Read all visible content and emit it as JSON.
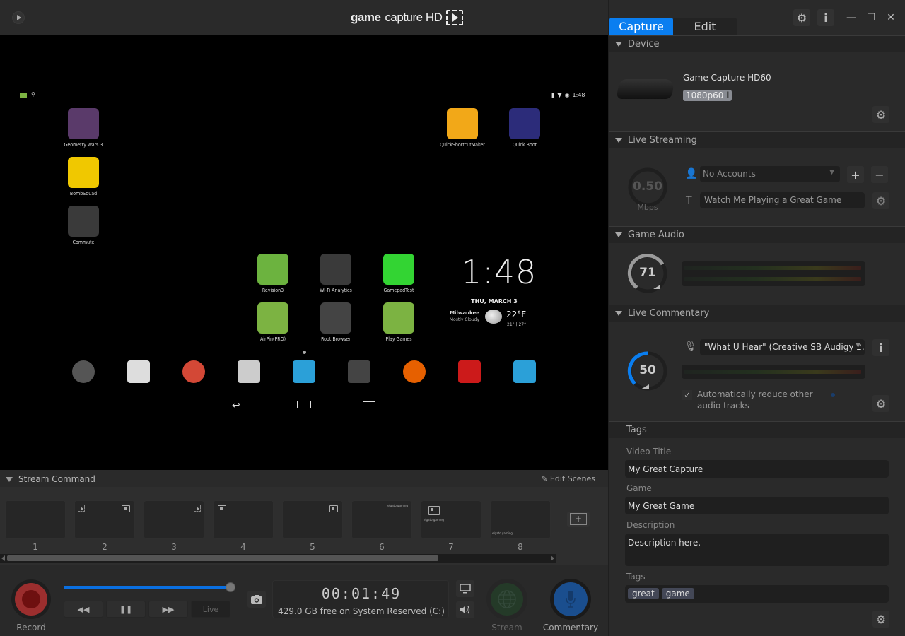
{
  "app": {
    "brand_bold": "game",
    "brand_thin": "capture HD"
  },
  "preview": {
    "status_time": "1:48",
    "apps_left": [
      {
        "label": "Geometry Wars 3",
        "color": "#5a3a6a"
      },
      {
        "label": "BombSquad",
        "color": "#f0c800"
      },
      {
        "label": "Commute",
        "color": "#3a3a3a"
      }
    ],
    "apps_top_right": [
      {
        "label": "QuickShortcutMaker",
        "color": "#f2a818"
      },
      {
        "label": "Quick Boot",
        "color": "#2c2c7a"
      }
    ],
    "apps_grid": [
      {
        "label": "Revision3",
        "color": "#6cb33f"
      },
      {
        "label": "Wi-Fi Analytics",
        "color": "#3a3a3a"
      },
      {
        "label": "GamepadTest",
        "color": "#33d433"
      },
      {
        "label": "AirPin(PRO)",
        "color": "#7cb342"
      },
      {
        "label": "Root Browser",
        "color": "#444444"
      },
      {
        "label": "Play Games",
        "color": "#7cb342"
      }
    ],
    "clock": "1:48",
    "date": "THU, MARCH 3",
    "city": "Milwaukee",
    "condition": "Mostly Cloudy",
    "temp": "22°F",
    "temp_range": "21° | 27°",
    "dock": [
      {
        "name": "app-drawer",
        "color": "#555555"
      },
      {
        "name": "play-store",
        "color": "#dddddd"
      },
      {
        "name": "chrome-beta",
        "color": "#d34836"
      },
      {
        "name": "settings",
        "color": "#cccccc"
      },
      {
        "name": "kodi",
        "color": "#2ba0d8"
      },
      {
        "name": "root-browser",
        "color": "#444444"
      },
      {
        "name": "firefox",
        "color": "#e66000"
      },
      {
        "name": "youtube",
        "color": "#cc1a1a"
      },
      {
        "name": "equalizer",
        "color": "#2ba0d8"
      }
    ]
  },
  "stream_command": {
    "title": "Stream Command",
    "edit_scenes": "Edit Scenes",
    "scenes": [
      "1",
      "2",
      "3",
      "4",
      "5",
      "6",
      "7",
      "8"
    ],
    "elgato_tag": "elgato gaming"
  },
  "controls": {
    "record_label": "Record",
    "live_label": "Live",
    "timer": "00:01:49",
    "disk_free": "429.0 GB free on System Reserved (C:)",
    "stream_label": "Stream",
    "commentary_label": "Commentary",
    "progress_fraction": 1.0
  },
  "panel": {
    "tabs": [
      {
        "label": "Capture",
        "active": true
      },
      {
        "label": "Edit",
        "active": false
      }
    ],
    "device": {
      "header": "Device",
      "name": "Game Capture HD60",
      "resolution": "1080p60"
    },
    "live_streaming": {
      "header": "Live Streaming",
      "bitrate": "0.50",
      "unit": "Mbps",
      "account_value": "No Accounts",
      "title_value": "Watch Me Playing a Great Game"
    },
    "game_audio": {
      "header": "Game Audio",
      "volume": "71"
    },
    "live_commentary": {
      "header": "Live Commentary",
      "volume": "50",
      "device_value": "\"What U Hear\"  (Creative SB Audigy 2...",
      "auto_reduce_label": "Automatically reduce other audio tracks",
      "auto_reduce_checked": true
    },
    "tags": {
      "header": "Tags",
      "video_title_label": "Video Title",
      "video_title_value": "My Great Capture",
      "game_label": "Game",
      "game_value": "My Great Game",
      "description_label": "Description",
      "description_value": "Description here.",
      "tags_label": "Tags",
      "tags": [
        "great",
        "game"
      ]
    }
  },
  "colors": {
    "accent": "#0a7ef0",
    "record": "#9b2e2e",
    "commentary": "#1a4e8e"
  }
}
